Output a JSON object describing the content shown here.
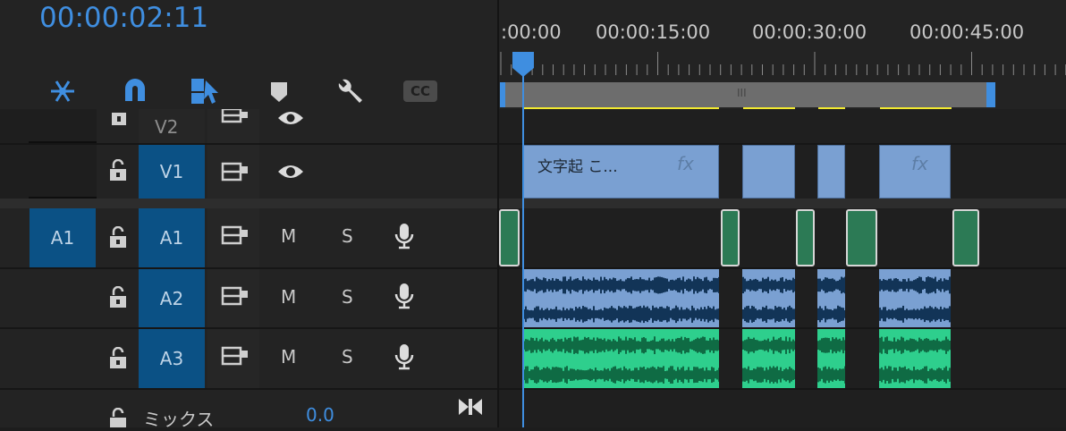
{
  "timecode": "00:00:02:11",
  "ruler": {
    "ticks": [
      ":00:00",
      "00:00:15:00",
      "00:00:30:00",
      "00:00:45:00"
    ]
  },
  "toolbar": {
    "tools": [
      {
        "name": "snap-nest-icon",
        "active": true
      },
      {
        "name": "magnet-snap-icon",
        "active": true
      },
      {
        "name": "linked-selection-icon",
        "active": true
      },
      {
        "name": "add-marker-icon",
        "active": false
      },
      {
        "name": "wrench-settings-icon",
        "active": false
      },
      {
        "name": "cc-captions-icon",
        "active": false
      }
    ],
    "cc_label": "CC"
  },
  "tracks": {
    "v2": {
      "label": "V2"
    },
    "v1": {
      "label": "V1",
      "clip_title": "文字起 こ...",
      "fx": "fx"
    },
    "a1": {
      "source_label": "A1",
      "label": "A1",
      "mute": "M",
      "solo": "S"
    },
    "a2": {
      "label": "A2",
      "mute": "M",
      "solo": "S"
    },
    "a3": {
      "label": "A3",
      "mute": "M",
      "solo": "S"
    },
    "mix": {
      "label": "ミックス",
      "value": "0.0"
    }
  },
  "clips": {
    "v1_second_fx": "fx",
    "scroll_handle": "III"
  },
  "colors": {
    "accent": "#3f8ee0",
    "track_target": "#0b5185",
    "video_clip": "#7aa0d2",
    "audio_clip_green": "#2ecf8d",
    "render_bar": "#f3ea2f"
  }
}
